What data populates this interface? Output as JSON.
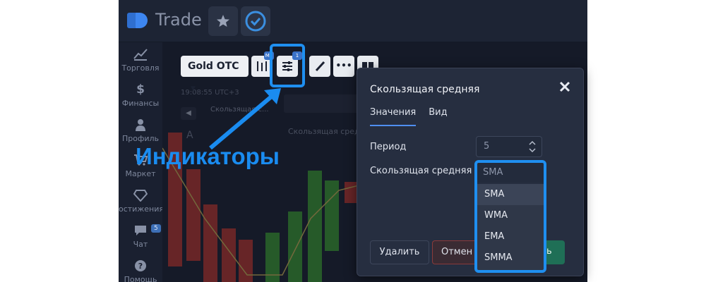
{
  "topbar": {
    "logo_text": "Trade",
    "star_icon": "star-icon",
    "check_icon": "check-circle-icon"
  },
  "sidebar": {
    "items": [
      {
        "label": "Торговля",
        "icon": "chart-icon"
      },
      {
        "label": "Финансы",
        "icon": "dollar-icon"
      },
      {
        "label": "Профиль",
        "icon": "user-icon"
      },
      {
        "label": "Маркет",
        "icon": "cart-icon"
      },
      {
        "label": "остижения",
        "icon": "diamond-icon"
      },
      {
        "label": "Чат",
        "icon": "chat-icon",
        "badge": "5"
      },
      {
        "label": "Помощь",
        "icon": "help-icon"
      }
    ]
  },
  "toolbar": {
    "asset": "Gold OTC",
    "indicator_count_badge": "1",
    "drawing_badge": "M5"
  },
  "chart": {
    "time": "19:08:55 UTC+3",
    "indicator_tag": "Скользящая с...",
    "indicator_name": "Скользящая средн...",
    "letter": "A"
  },
  "annotation": {
    "text": "Индикаторы"
  },
  "dialog": {
    "title": "Скользящая средняя",
    "tabs": [
      "Значения",
      "Вид"
    ],
    "period_label": "Период",
    "period_value": "5",
    "ma_label": "Скользящая средняя",
    "ma_selected": "SMA",
    "options": [
      "SMA",
      "WMA",
      "EMA",
      "SMMA"
    ],
    "delete_button": "Удалить",
    "cancel_button": "Отмен",
    "ok_button": "ь"
  },
  "colors": {
    "highlight": "#1f8ff0",
    "candle_red": "#c2372f",
    "candle_green": "#3fa53a"
  }
}
